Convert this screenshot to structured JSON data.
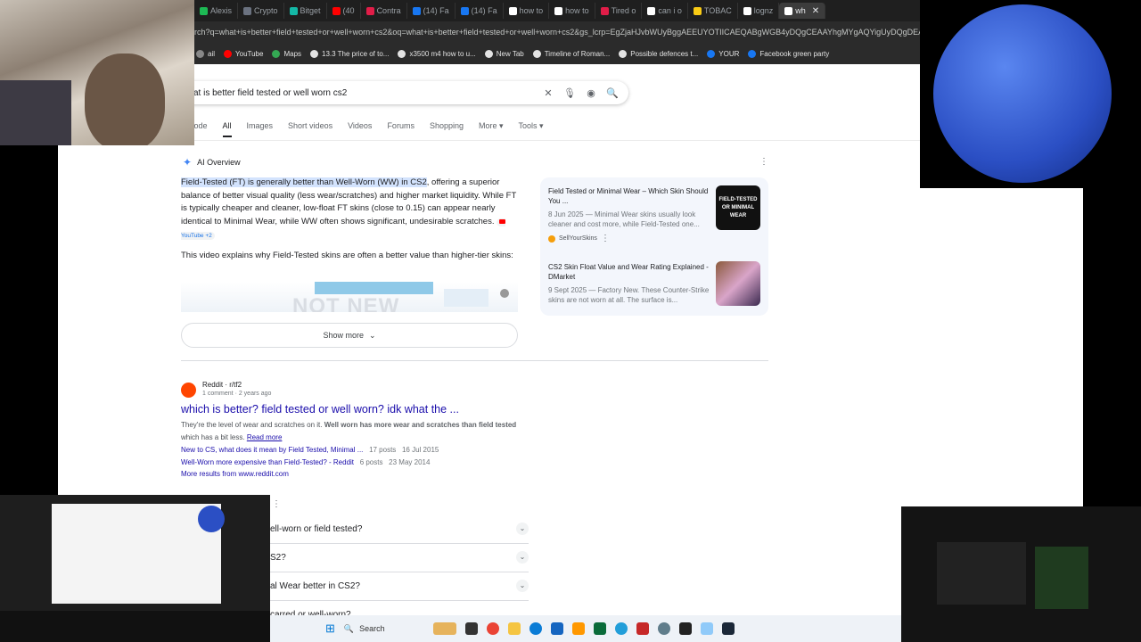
{
  "tabs": [
    {
      "label": "Alexis",
      "color": "#1db954"
    },
    {
      "label": "Crypto",
      "color": "#6b7280"
    },
    {
      "label": "Bitget",
      "color": "#14b8a6"
    },
    {
      "label": "(40",
      "color": "#ff0000"
    },
    {
      "label": "Contra",
      "color": "#e11d48"
    },
    {
      "label": "(14) Fa",
      "color": "#1877f2"
    },
    {
      "label": "(14) Fa",
      "color": "#1877f2"
    },
    {
      "label": "how to",
      "color": "#ffffff"
    },
    {
      "label": "how to",
      "color": "#ffffff"
    },
    {
      "label": "Tired o",
      "color": "#e11d48"
    },
    {
      "label": "can i o",
      "color": "#ffffff"
    },
    {
      "label": "TOBAC",
      "color": "#facc15"
    },
    {
      "label": "lognz",
      "color": "#ffffff"
    },
    {
      "label": "wh",
      "color": "#ffffff",
      "active": true
    }
  ],
  "url": "rch?q=what+is+better+field+tested+or+well+worn+cs2&oq=what+is+better+field+tested+or+well+worn+cs2&gs_lcrp=EgZjaHJvbWUyBggAEEUYOTIICAEQABgWGB4yDQgCEAAYhgMYgAQYigUyDQgDEAAYhgMYgAQYi",
  "bookmarks": [
    "ail",
    "YouTube",
    "Maps",
    "13.3 The price of to...",
    "x3500 m4 how to u...",
    "New Tab",
    "Timeline of Roman...",
    "Possible defences t...",
    "YOUR",
    "Facebook green party"
  ],
  "search": {
    "query": "at is better field tested or well worn cs2"
  },
  "filters": [
    "Mode",
    "All",
    "Images",
    "Short videos",
    "Videos",
    "Forums",
    "Shopping",
    "More ▾",
    "Tools ▾"
  ],
  "ai_overview": {
    "heading": "AI Overview",
    "highlight": "Field-Tested (FT) is generally better than Well-Worn (WW) in CS2",
    "body": ", offering a superior balance of better visual quality (less wear/scratches) and higher market liquidity. While FT is typically cheaper and cleaner, low-float FT skins (close to 0.15) can appear nearly identical to Minimal Wear, while WW often shows significant, undesirable scratches.",
    "chip": "YouTube +2",
    "video_intro": "This video explains why Field-Tested skins are often a better value than higher-tier skins:",
    "video_text": "NOT NEW",
    "show_more": "Show more"
  },
  "sources": [
    {
      "title": "Field Tested or Minimal Wear – Which Skin Should You ...",
      "meta": "8 Jun 2025 — Minimal Wear skins usually look cleaner and cost more, while Field-Tested one...",
      "site": "SellYourSkins",
      "thumb_text": "FIELD-TESTED OR MINIMAL WEAR"
    },
    {
      "title": "CS2 Skin Float Value and Wear Rating Explained - DMarket",
      "meta": "9 Sept 2025 — Factory New. These Counter-Strike skins are not worn at all. The surface is..."
    }
  ],
  "result": {
    "site": "Reddit · r/tf2",
    "meta": "1 comment · 2 years ago",
    "title": "which is better? field tested or well worn? idk what the ...",
    "snippet_a": "They're the level of wear and scratches on it. ",
    "snippet_b": "Well worn has more wear and scratches than field tested",
    "snippet_c": " which has a bit less. ",
    "read_more": "Read more",
    "sublinks": [
      {
        "text": "New to CS, what does it mean by Field Tested, Minimal ...",
        "posts": "17 posts",
        "date": "16 Jul 2015"
      },
      {
        "text": "Well-Worn more expensive than Field-Tested? - Reddit",
        "posts": "6 posts",
        "date": "23 May 2014"
      }
    ],
    "more": "More results from www.reddit.com"
  },
  "paa": [
    "ell-worn or field tested?",
    "S2?",
    "al Wear better in CS2?",
    "carred or well-worn?"
  ],
  "taskbar": {
    "search": "Search"
  }
}
